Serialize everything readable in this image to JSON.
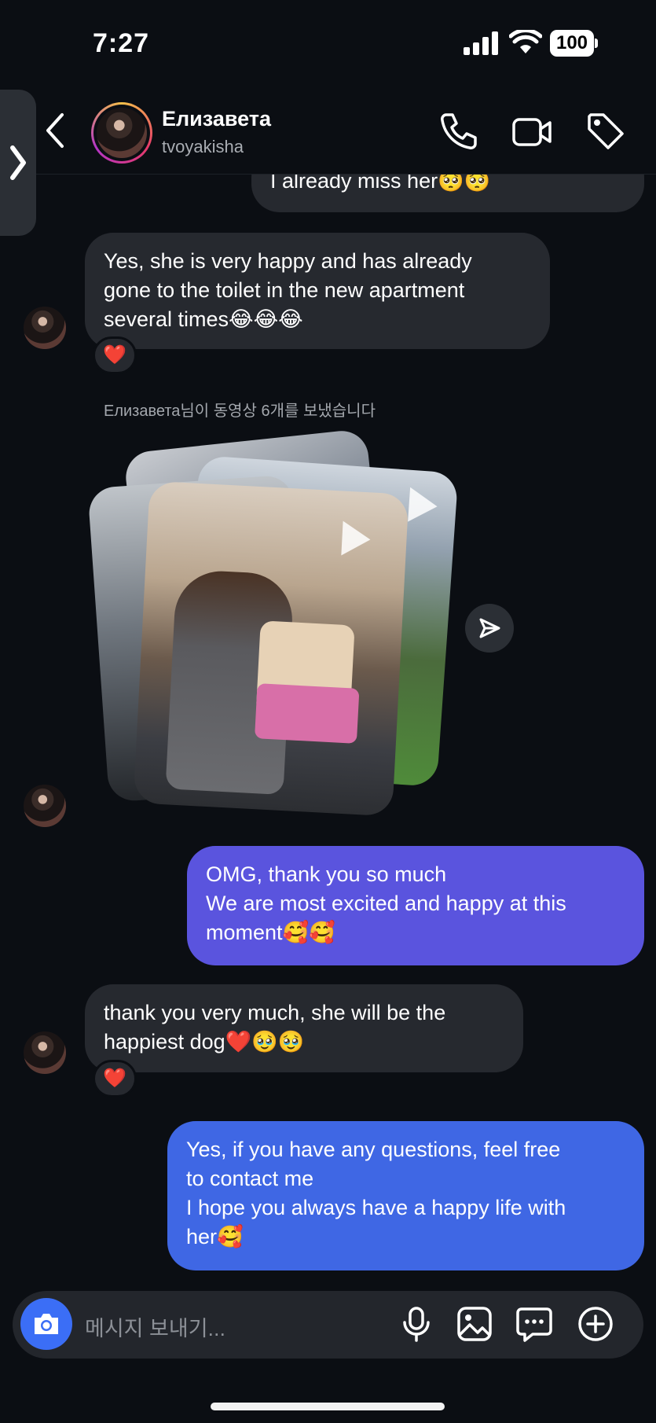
{
  "status_bar": {
    "time": "7:27",
    "battery": "100"
  },
  "header": {
    "name": "Елизавета",
    "username": "tvoyakisha"
  },
  "messages": {
    "m0": {
      "text": "I already miss her🥺🥺"
    },
    "m1": {
      "lines": [
        "Yes, she is very happy and has already",
        "gone to the toilet in the new apartment",
        "several times😂😂😂"
      ],
      "reaction": "❤️"
    },
    "system": "Елизавета님이 동영상 6개를 보냈습니다",
    "m2": {
      "lines": [
        "OMG, thank you so much",
        "We are most excited and happy at this",
        "moment🥰🥰"
      ]
    },
    "m3": {
      "lines": [
        "thank you very much, she will be the",
        "happiest dog❤️🥹🥹"
      ],
      "reaction": "❤️"
    },
    "m4": {
      "lines": [
        "Yes, if you have any questions, feel free",
        "to contact me",
        "I hope you always have a happy life with",
        "her🥰"
      ]
    }
  },
  "composer": {
    "placeholder": "메시지 보내기..."
  },
  "icons": [
    "chevron-right-icon",
    "back-chevron-icon",
    "phone-icon",
    "video-call-icon",
    "tag-icon",
    "play-icon",
    "send-icon",
    "camera-icon",
    "microphone-icon",
    "gallery-icon",
    "sticker-message-icon",
    "add-circle-icon"
  ],
  "colors": {
    "background": "#0b0e13",
    "incoming_bubble": "#26292f",
    "outgoing_top": "#5a54de",
    "outgoing_bottom": "#3f67e4",
    "camera_button": "#3b6ef6"
  }
}
